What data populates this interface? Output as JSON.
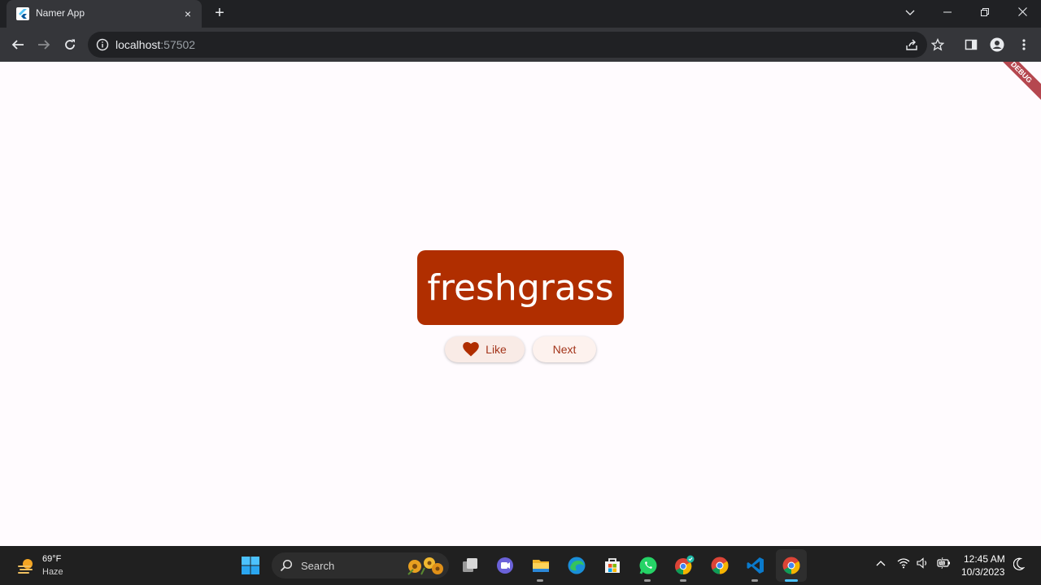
{
  "browser": {
    "tab_title": "Namer App",
    "tab_close": "×",
    "new_tab": "+",
    "url_host": "localhost",
    "url_port": ":57502"
  },
  "app": {
    "word": "freshgrass",
    "like_label": "Like",
    "next_label": "Next",
    "debug_label": "DEBUG",
    "colors": {
      "card": "#b02e00",
      "button_text": "#a3341a",
      "background": "#fffbfe",
      "heart": "#b02e00"
    }
  },
  "taskbar": {
    "weather_temp": "69°F",
    "weather_desc": "Haze",
    "search_label": "Search",
    "time": "12:45 AM",
    "date": "10/3/2023"
  }
}
